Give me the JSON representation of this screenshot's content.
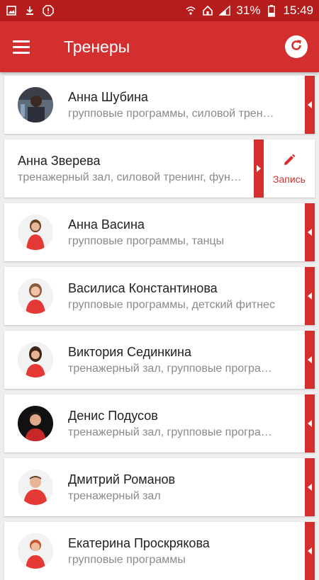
{
  "status_bar": {
    "battery": "31%",
    "time": "15:49"
  },
  "app_bar": {
    "title": "Тренеры"
  },
  "trainers": [
    {
      "name": "Анна Шубина",
      "desc": "групповые программы, силовой тренинг"
    },
    {
      "name": "Анна Зверева",
      "desc": "тренажерный зал, силовой тренинг, функциональный тренинг",
      "action": "Запись"
    },
    {
      "name": "Анна Васина",
      "desc": "групповые программы, танцы"
    },
    {
      "name": "Василиса Константинова",
      "desc": "групповые программы, детский фитнес"
    },
    {
      "name": "Виктория Сединкина",
      "desc": "тренажерный зал, групповые программы"
    },
    {
      "name": "Денис Подусов",
      "desc": "тренажерный зал, групповые программы"
    },
    {
      "name": "Дмитрий Романов",
      "desc": "тренажерный зал"
    },
    {
      "name": "Екатерина Проскрякова",
      "desc": "групповые программы"
    }
  ],
  "colors": {
    "primary": "#d32f2f",
    "primary_dark": "#b71c1c",
    "card": "#ffffff",
    "background": "#eeeeee"
  }
}
